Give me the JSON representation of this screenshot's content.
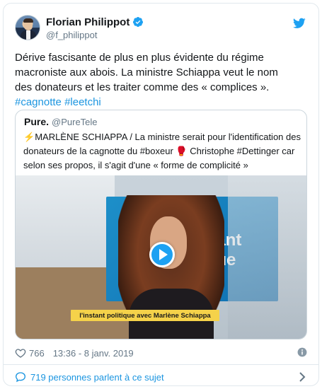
{
  "author": {
    "display_name": "Florian Philippot",
    "handle": "@f_philippot",
    "verified": true,
    "avatar_icon": "profile-photo"
  },
  "tweet": {
    "text_plain": "Dérive fascisante de plus en plus évidente du régime macroniste aux abois. La ministre Schiappa veut le nom des donateurs et les traiter comme des « complices ». ",
    "hashtag_1": "#cagnotte",
    "hashtag_2": "#leetchi"
  },
  "quoted_tweet": {
    "display_name": "Pure.",
    "handle": "@PureTele",
    "emoji_bolt": "⚡",
    "text_part_1": "MARLÈNE SCHIAPPA / La ministre serait pour l'identification des donateurs de la cagnotte du #boxeur ",
    "emoji_glove": "🥊",
    "text_part_2": " Christophe #Dettinger car selon ses propos, il s'agit d'une « forme de complicité »",
    "video": {
      "panel_text_line_1": "stant",
      "panel_text_line_2": "ique",
      "caption": "l'instant politique avec Marlène Schiappa"
    }
  },
  "meta": {
    "likes": "766",
    "timestamp": "13:36 - 8 janv. 2019"
  },
  "footer": {
    "conversation_label": "719 personnes parlent à ce sujet"
  },
  "colors": {
    "twitter_blue": "#1da1f2",
    "link_blue": "#1b95e0",
    "text_primary": "#14171a",
    "text_secondary": "#657786",
    "border": "#e1e8ed"
  }
}
